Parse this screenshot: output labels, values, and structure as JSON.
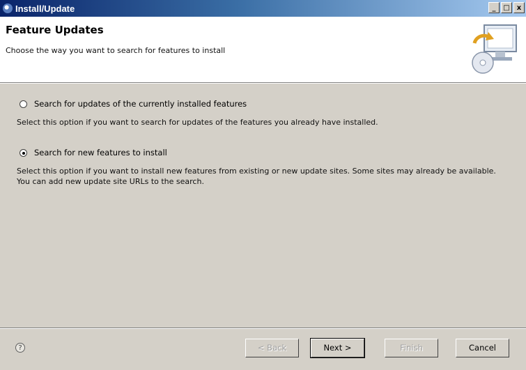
{
  "window": {
    "title": "Install/Update",
    "controls": {
      "minimize": "_",
      "maximize": "□",
      "close": "x"
    }
  },
  "header": {
    "title": "Feature Updates",
    "description": "Choose the way you want to search for features to install",
    "icon": "install-wizard-icon"
  },
  "options": [
    {
      "label": "Search for updates of the currently installed features",
      "description": "Select this option if you want to search for updates of the features you already have installed.",
      "selected": false
    },
    {
      "label": "Search for new features to install",
      "description": "Select this option if you want to install new features from existing or new update sites. Some sites may already be available. You can add new update site URLs to the search.",
      "selected": true
    }
  ],
  "footer": {
    "help": "?",
    "back": "< Back",
    "next": "Next >",
    "finish": "Finish",
    "cancel": "Cancel"
  }
}
